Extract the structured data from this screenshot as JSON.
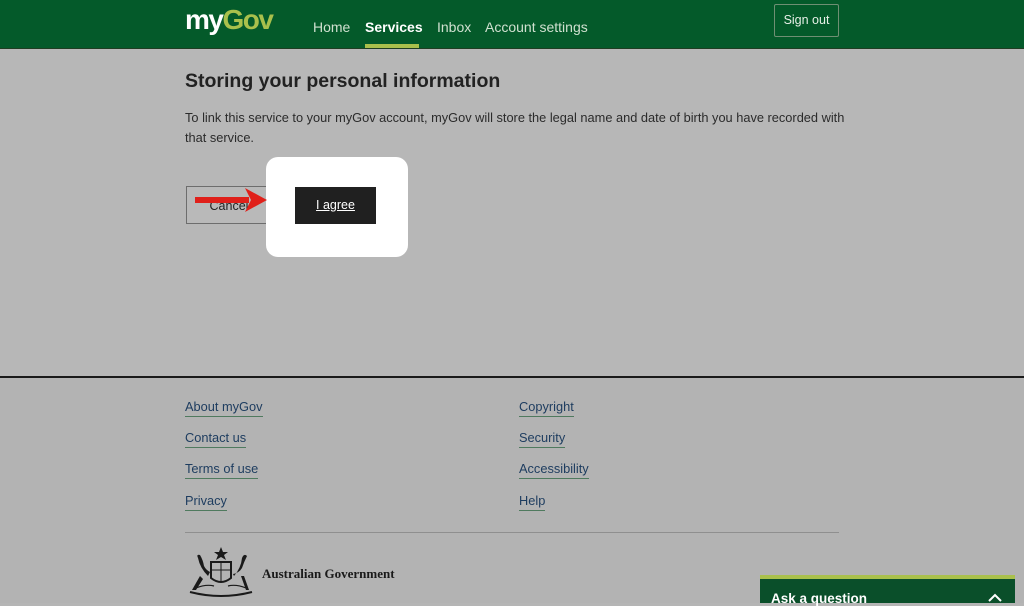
{
  "header": {
    "logo_my": "my",
    "logo_gov": "Gov",
    "nav": [
      {
        "label": "Home"
      },
      {
        "label": "Services",
        "active": true
      },
      {
        "label": "Inbox"
      },
      {
        "label": "Account settings"
      }
    ],
    "signout_label": "Sign out"
  },
  "main": {
    "title": "Storing your personal information",
    "intro": "To link this service to your myGov account, myGov will store the legal name and date of birth you have recorded with that service.",
    "cancel_label": "Cancel",
    "agree_label": "I agree"
  },
  "footer": {
    "left_links": [
      "About myGov",
      "Contact us",
      "Terms of use",
      "Privacy"
    ],
    "right_links": [
      "Copyright",
      "Security",
      "Accessibility",
      "Help"
    ],
    "gov_text": "Australian Government"
  },
  "ask": {
    "label": "Ask a question"
  },
  "colors": {
    "header_green": "#045a2a",
    "accent_lime": "#a9c04c",
    "annotation_red": "#e0201a"
  },
  "icons": {
    "arrow": "red-arrow-right-icon",
    "crest": "coat-of-arms-icon",
    "chevron": "chevron-up-icon"
  }
}
